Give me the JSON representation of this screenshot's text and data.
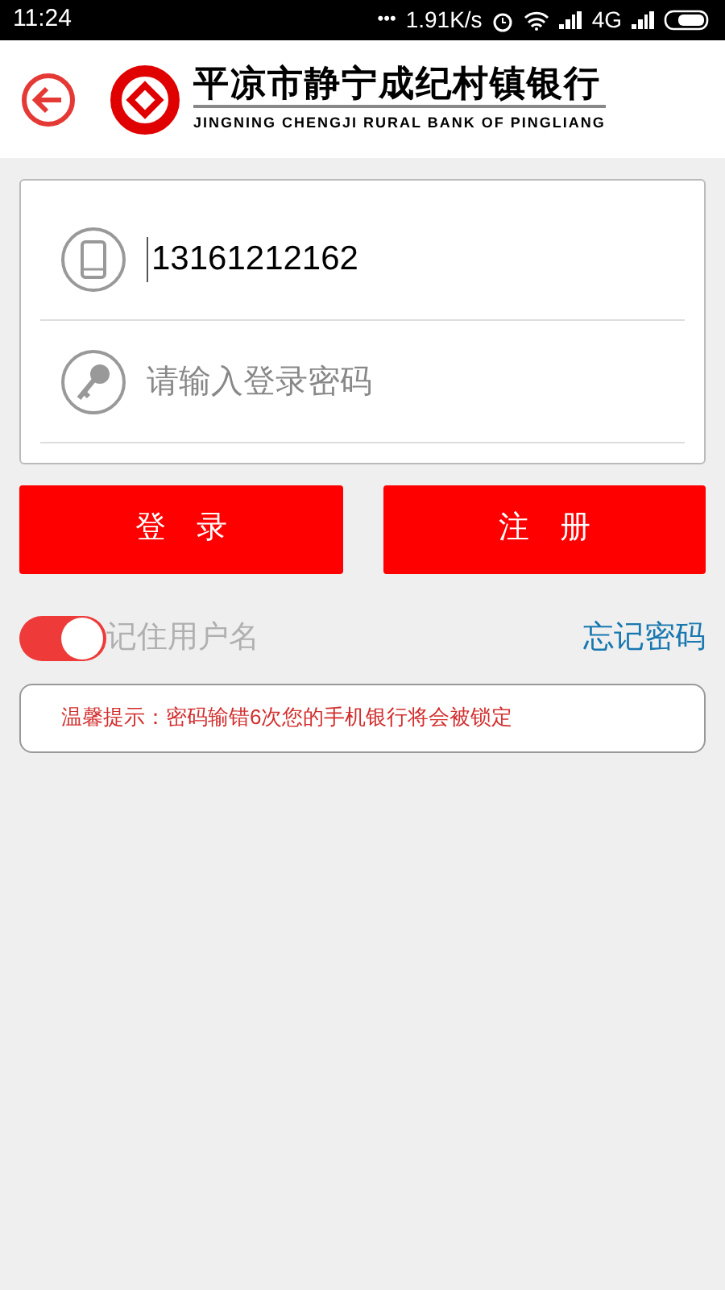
{
  "status_bar": {
    "time": "11:24",
    "dots": "•••",
    "speed": "1.91K/s",
    "network": "4G"
  },
  "header": {
    "title": "平凉市静宁成纪村镇银行",
    "subtitle": "JINGNING CHENGJI RURAL BANK OF PINGLIANG"
  },
  "login_form": {
    "phone": {
      "value": "13161212162"
    },
    "password": {
      "placeholder": "请输入登录密码"
    }
  },
  "buttons": [
    {
      "label": "登　录"
    },
    {
      "label": "注　册"
    }
  ],
  "remember": {
    "label": "记住用户名",
    "on": true
  },
  "forgot_link": "忘记密码",
  "notice": "温馨提示：密码输错6次您的手机银行将会被锁定"
}
